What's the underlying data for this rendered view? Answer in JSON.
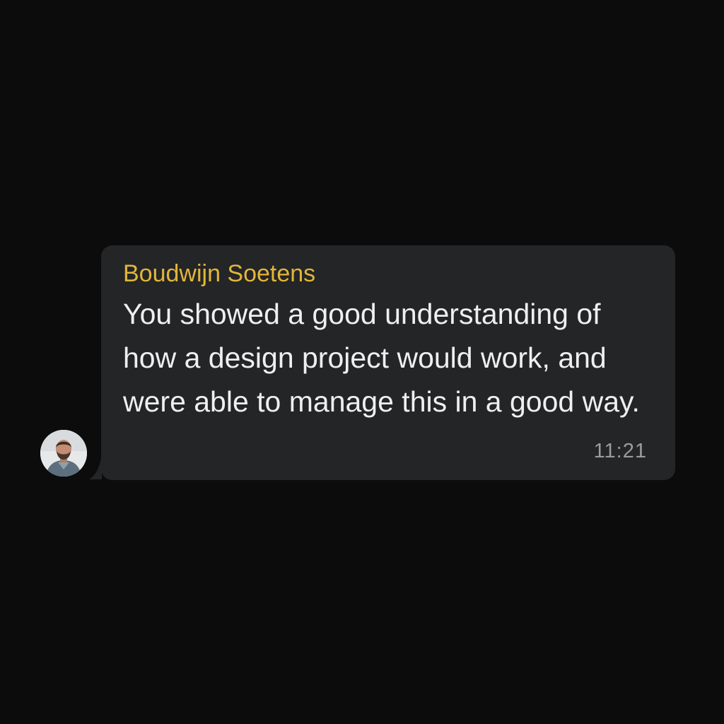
{
  "message": {
    "sender_name": "Boudwijn Soetens",
    "text": "You showed a good understanding of how a design project would work, and were able to manage this in a good way.",
    "timestamp": "11:21"
  },
  "avatar": {
    "icon": "person-avatar"
  },
  "colors": {
    "background": "#0c0c0c",
    "bubble": "#232526",
    "sender_name": "#e2b53a",
    "message_text": "#efefef",
    "timestamp": "#9a9c9e"
  }
}
